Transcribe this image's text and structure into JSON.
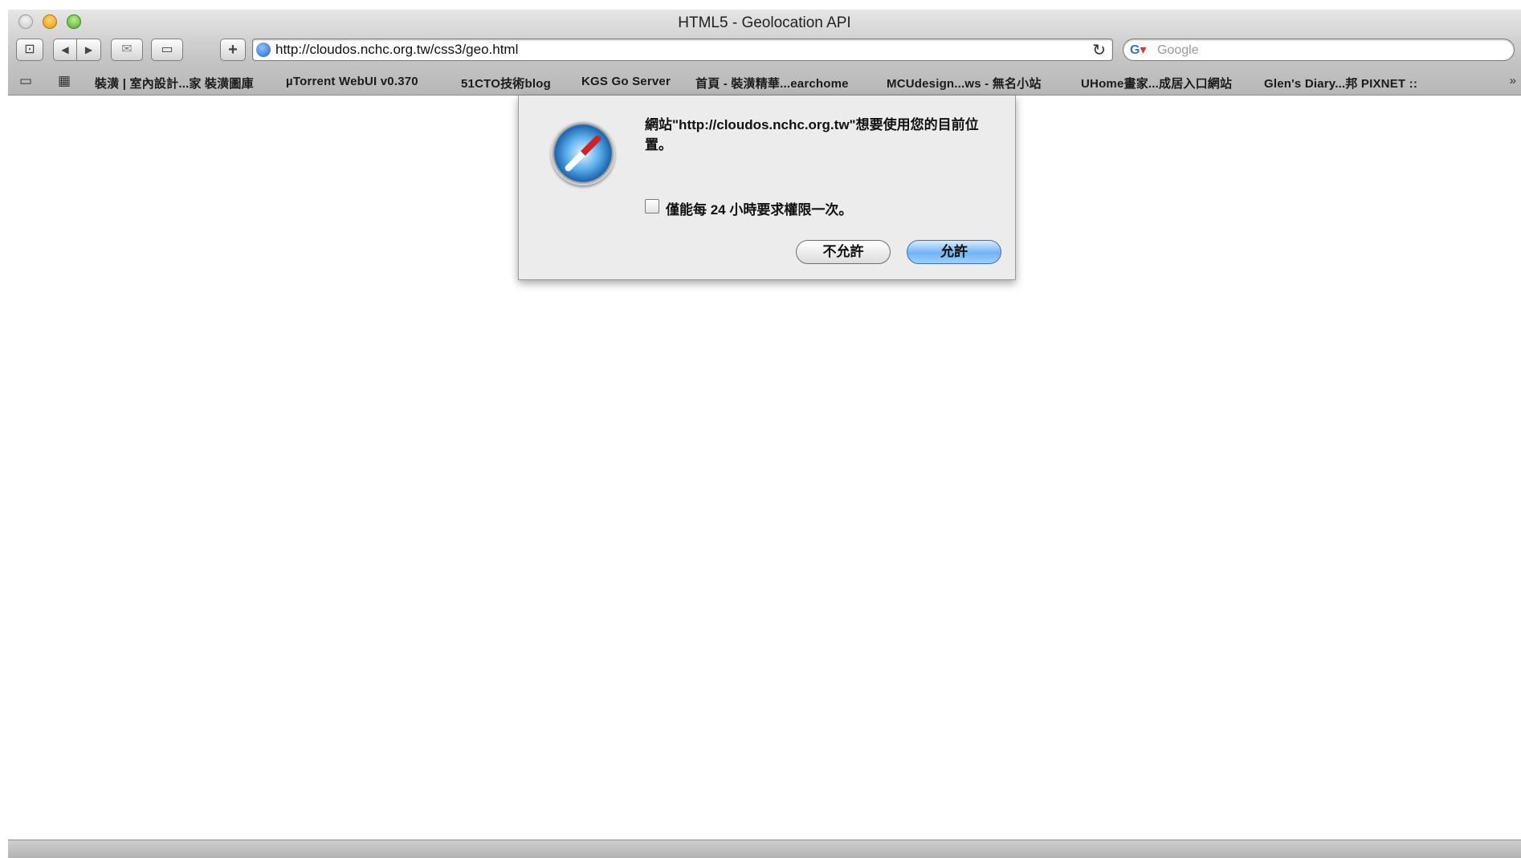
{
  "window": {
    "title": "HTML5 - Geolocation API"
  },
  "toolbar": {
    "add_bookmark_glyph": "⊡",
    "back_glyph": "◀",
    "forward_glyph": "▶",
    "snapback_glyph": "✉",
    "reader_glyph": "▭",
    "add_glyph": "+",
    "url": "http://cloudos.nchc.org.tw/css3/geo.html",
    "reload_glyph": "↻",
    "search_placeholder": "Google"
  },
  "bookmarks": {
    "items": [
      "裝潢 | 室內設計...家 裝潢圖庫",
      "µTorrent WebUI v0.370",
      "51CTO技術blog",
      "KGS Go Server",
      "首頁 - 裝潢精華...earchome",
      "MCUdesign...ws - 無名小站",
      "UHome畫家...成居入口網站",
      "Glen's Diary...邦 PIXNET ::"
    ],
    "more_glyph": "»"
  },
  "dialog": {
    "message": "網站\"http://cloudos.nchc.org.tw\"想要使用您的目前位置。",
    "remember_label": "僅能每 24 小時要求權限一次。",
    "deny_label": "不允許",
    "allow_label": "允許"
  },
  "icons": {
    "app": "safari-compass-icon",
    "address": "globe-icon",
    "search": "google-icon"
  }
}
